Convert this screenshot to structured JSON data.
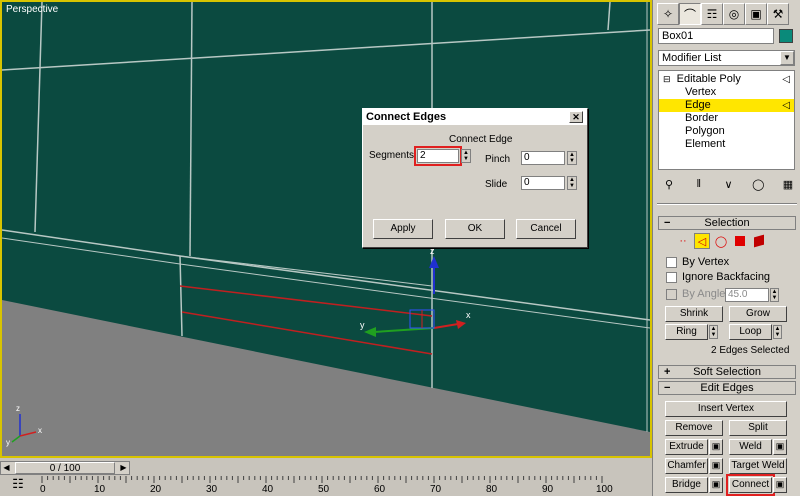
{
  "viewport": {
    "label": "Perspective",
    "gizmo": {
      "x_label": "x",
      "y_label": "y",
      "z_label": "z"
    },
    "axis_tripod": {
      "x_label": "x",
      "y_label": "y",
      "z_label": "z"
    }
  },
  "timeline": {
    "frame_display": "0 / 100",
    "ruler_ticks": [
      "0",
      "10",
      "20",
      "30",
      "40",
      "50",
      "60",
      "70",
      "80",
      "90",
      "100"
    ]
  },
  "command_panel": {
    "object_name": "Box01",
    "object_color": "#0a8a7a",
    "modifier_list_label": "Modifier List",
    "stack": {
      "root": "Editable Poly",
      "items": [
        "Vertex",
        "Edge",
        "Border",
        "Polygon",
        "Element"
      ],
      "selected": "Edge"
    },
    "selection_rollout": {
      "title": "Selection",
      "by_vertex": "By Vertex",
      "ignore_backfacing": "Ignore Backfacing",
      "by_angle": "By Angle:",
      "by_angle_value": "45.0",
      "shrink": "Shrink",
      "grow": "Grow",
      "ring": "Ring",
      "loop": "Loop",
      "status": "2 Edges Selected"
    },
    "soft_selection": {
      "title": "Soft Selection"
    },
    "edit_edges": {
      "title": "Edit Edges",
      "insert_vertex": "Insert Vertex",
      "remove": "Remove",
      "split": "Split",
      "extrude": "Extrude",
      "weld": "Weld",
      "chamfer": "Chamfer",
      "target_weld": "Target Weld",
      "bridge": "Bridge",
      "connect": "Connect"
    }
  },
  "dialog": {
    "title": "Connect Edges",
    "group_label": "Connect Edge",
    "segments_label": "Segments:",
    "segments_value": "2",
    "pinch_label": "Pinch",
    "pinch_value": "0",
    "slide_label": "Slide",
    "slide_value": "0",
    "apply": "Apply",
    "ok": "OK",
    "cancel": "Cancel"
  }
}
